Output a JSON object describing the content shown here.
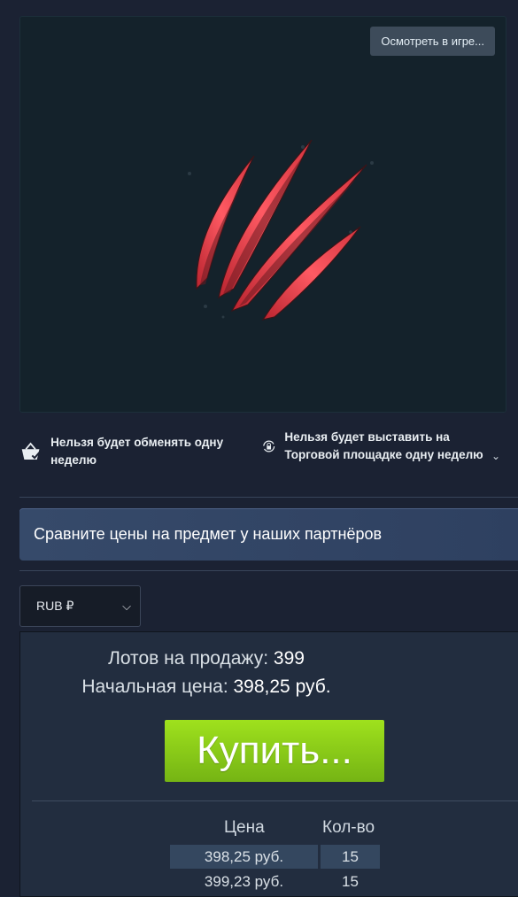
{
  "preview": {
    "inspect_label": "Осмотреть в игре..."
  },
  "restrictions": {
    "trade": "Нельзя будет обменять одну неделю",
    "market": "Нельзя будет выставить на Торговой площадке одну неделю"
  },
  "partners_banner": "Сравните цены на предмет у наших партнёров",
  "currency": {
    "selected": "RUB ₽"
  },
  "market": {
    "listings_label": "Лотов на продажу:",
    "listings_count": "399",
    "start_price_label": "Начальная цена:",
    "start_price": "398,25 руб.",
    "buy_label": "Купить...",
    "columns": {
      "price": "Цена",
      "qty": "Кол-во"
    },
    "rows": [
      {
        "price": "398,25 руб.",
        "qty": "15"
      },
      {
        "price": "399,23 руб.",
        "qty": "15"
      }
    ]
  },
  "colors": {
    "background": "#1b2233",
    "buy_button": "#8ccf18",
    "claw": "#e8454f"
  }
}
